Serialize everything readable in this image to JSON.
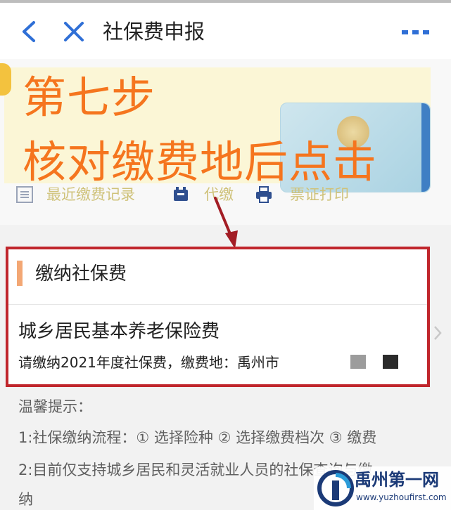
{
  "nav": {
    "title": "社保费申报",
    "back_icon": "chevron-left-icon",
    "close_icon": "close-icon",
    "more_icon": "more-dots-icon"
  },
  "banner": {
    "overlay_line1": "第七步",
    "overlay_line2": "核对缴费地后点击"
  },
  "quick_actions": [
    {
      "label": "最近缴费记录",
      "icon": "list-icon"
    },
    {
      "label": "代缴",
      "icon": "wallet-icon"
    },
    {
      "label": "票证打印",
      "icon": "printer-icon"
    }
  ],
  "section": {
    "title": "缴纳社保费",
    "item_name": "城乡居民基本养老保险费",
    "item_desc": "请缴纳2021年度社保费，缴费地：禹州市"
  },
  "tips": {
    "header": "温馨提示：",
    "lines": [
      "1:社保缴纳流程：① 选择险种 ② 选择缴费档次 ③ 缴费",
      "2:目前仅支持城乡居民和灵活就业人员的社保查询与缴",
      "纳"
    ]
  },
  "watermark": {
    "title": "禹州第一网",
    "url": "www.yuzhoufirst.com"
  },
  "colors": {
    "overlay_text": "#f5751e",
    "highlight_border": "#c0262c",
    "nav_icon": "#2f6fd6",
    "section_accent": "#f3a774"
  }
}
